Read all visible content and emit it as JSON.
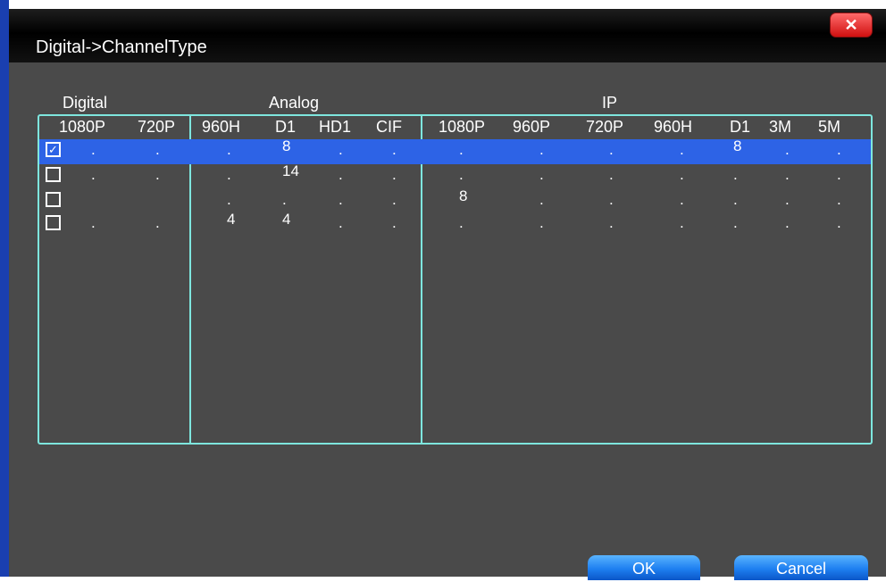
{
  "window": {
    "title": "Digital->ChannelType",
    "close_icon": "close-icon"
  },
  "groups": {
    "digital": "Digital",
    "analog": "Analog",
    "ip": "IP"
  },
  "columns": [
    "1080P",
    "720P",
    "960H",
    "D1",
    "HD1",
    "CIF",
    "1080P",
    "960P",
    "720P",
    "960H",
    "D1",
    "3M",
    "5M"
  ],
  "rows": [
    {
      "checked": true,
      "cells": [
        ".",
        ".",
        ".",
        "8",
        ".",
        ".",
        ".",
        ".",
        ".",
        ".",
        "8",
        ".",
        "."
      ]
    },
    {
      "checked": false,
      "cells": [
        ".",
        ".",
        ".",
        "14",
        ".",
        ".",
        ".",
        ".",
        ".",
        ".",
        ".",
        ".",
        "."
      ]
    },
    {
      "checked": false,
      "cells": [
        "",
        "",
        ".",
        ".",
        ".",
        ".",
        "8",
        ".",
        ".",
        ".",
        ".",
        ".",
        "."
      ]
    },
    {
      "checked": false,
      "cells": [
        ".",
        ".",
        "4",
        "4",
        ".",
        ".",
        ".",
        ".",
        ".",
        ".",
        ".",
        ".",
        "."
      ]
    }
  ],
  "buttons": {
    "ok": "OK",
    "cancel": "Cancel"
  },
  "colors": {
    "window_bg": "#4a4a4a",
    "table_border": "#7ee6de",
    "selection": "#2d63e6",
    "button": "#1e7ff0",
    "close": "#e02020"
  }
}
